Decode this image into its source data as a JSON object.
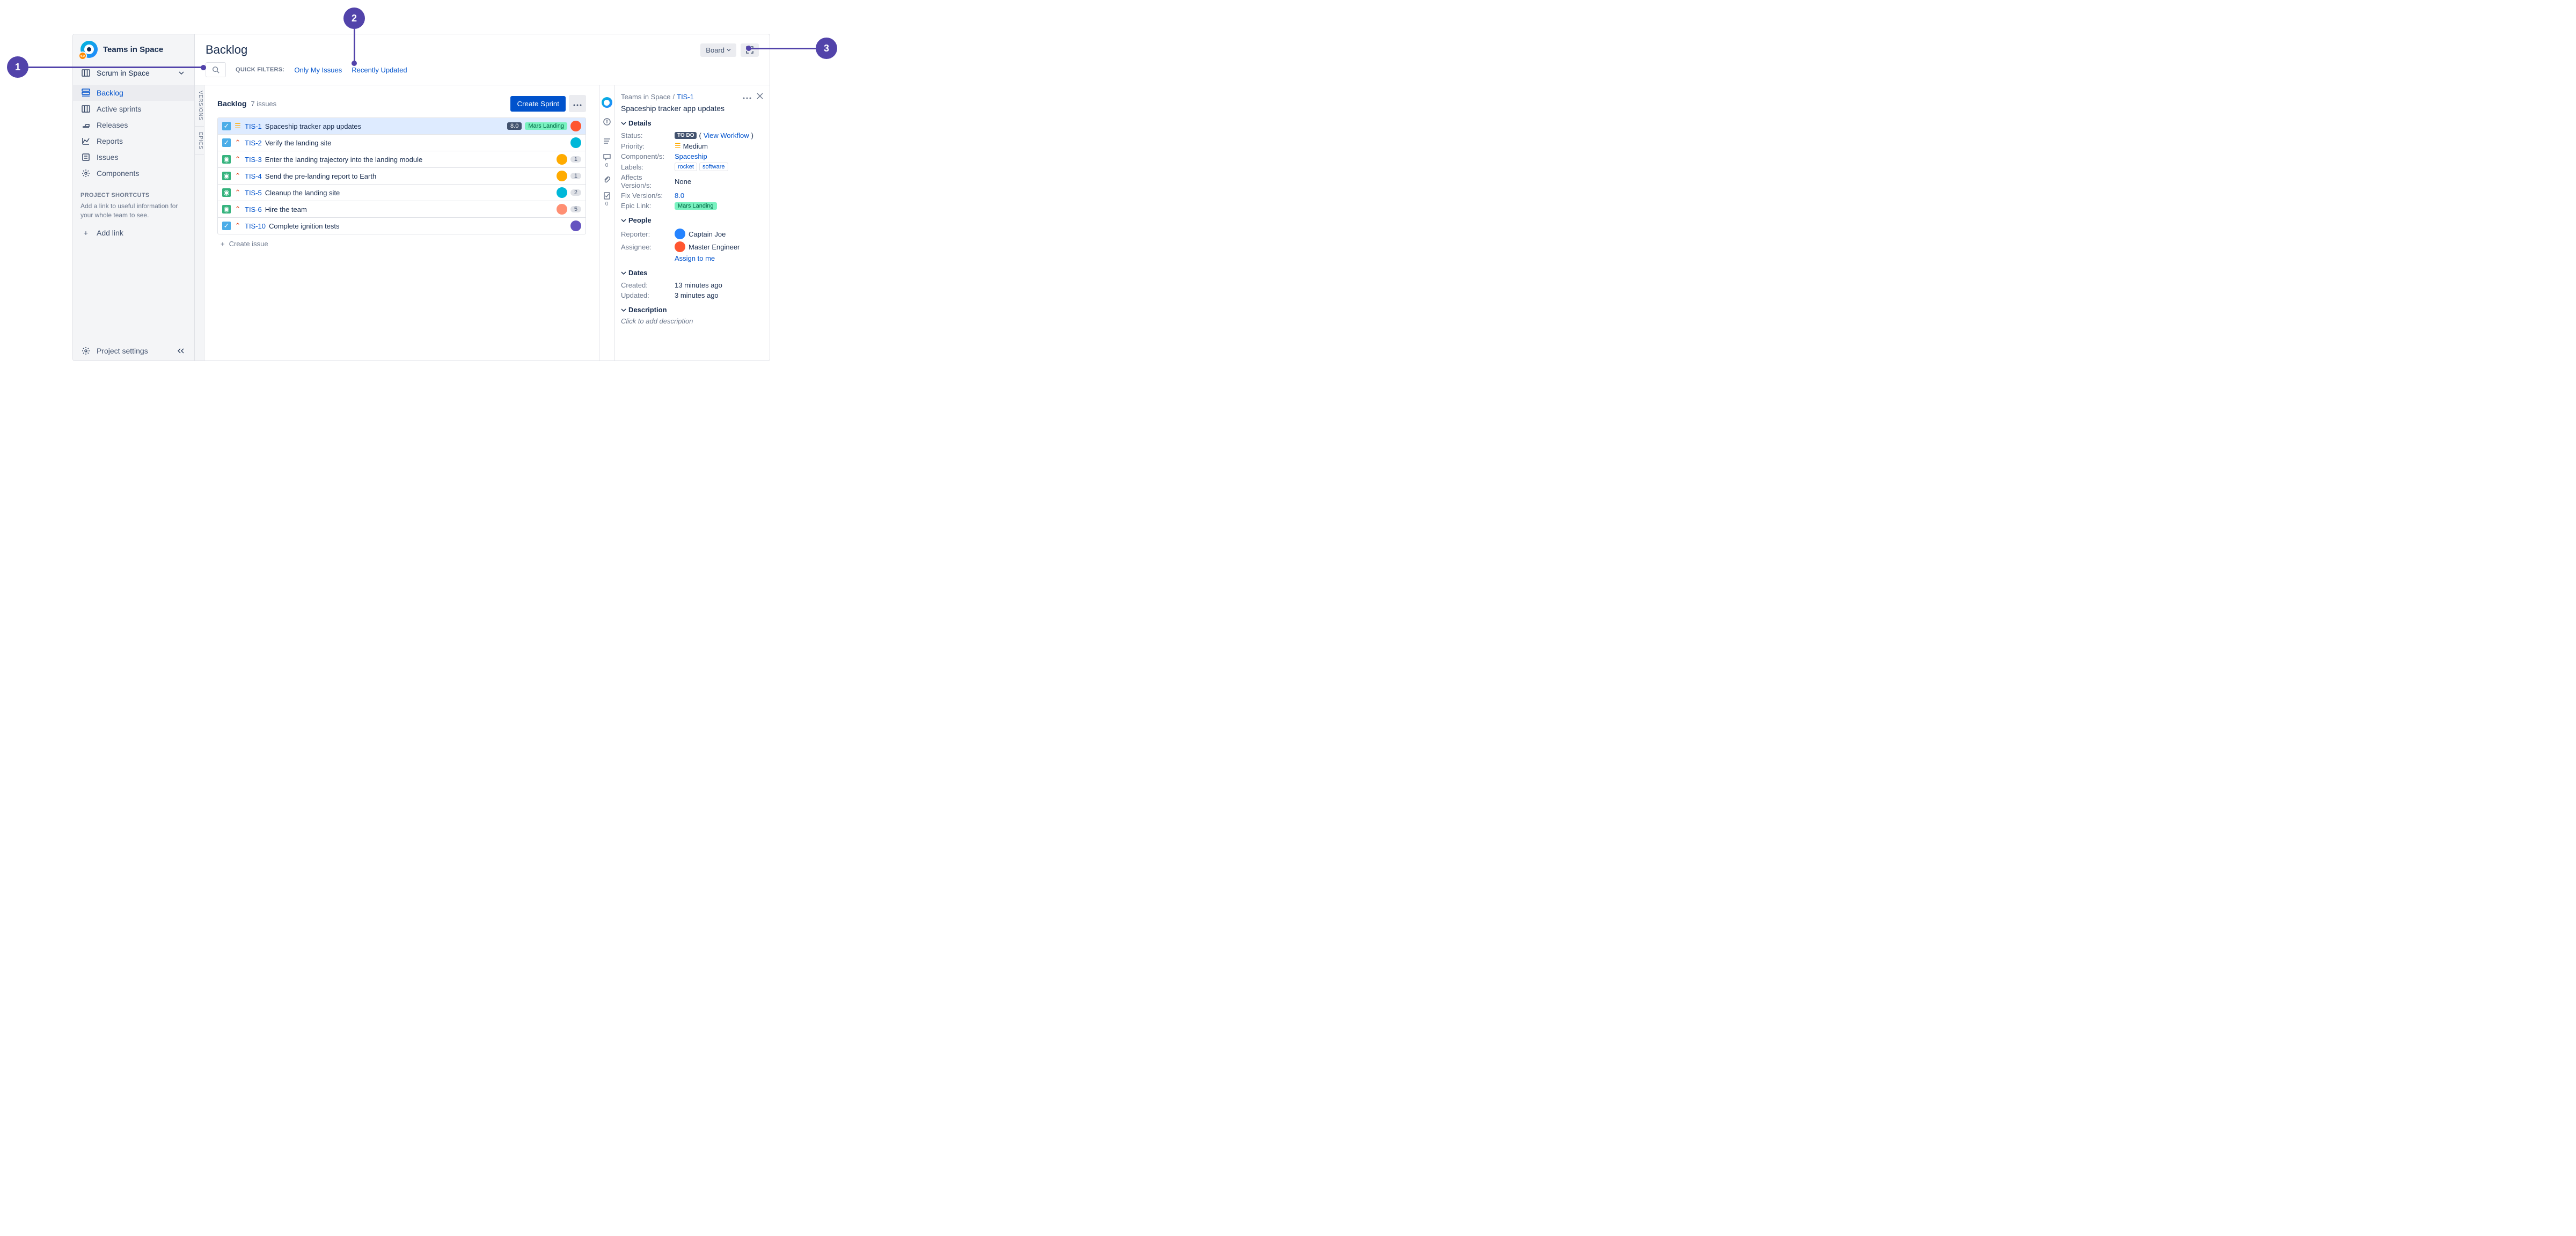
{
  "callouts": {
    "c1": "1",
    "c2": "2",
    "c3": "3"
  },
  "project": {
    "name": "Teams in Space",
    "board": "Scrum in Space"
  },
  "nav": {
    "backlog": "Backlog",
    "active_sprints": "Active sprints",
    "releases": "Releases",
    "reports": "Reports",
    "issues": "Issues",
    "components": "Components"
  },
  "shortcuts": {
    "title": "PROJECT SHORTCUTS",
    "desc": "Add a link to useful information for your whole team to see.",
    "add": "Add link"
  },
  "footer": {
    "settings": "Project settings"
  },
  "header": {
    "title": "Backlog",
    "board_btn": "Board",
    "filters_label": "QUICK FILTERS:",
    "filter_my": "Only My Issues",
    "filter_recent": "Recently Updated"
  },
  "vtabs": {
    "versions": "VERSIONS",
    "epics": "EPICS"
  },
  "backlog": {
    "title": "Backlog",
    "count": "7 issues",
    "create_sprint": "Create Sprint",
    "create_issue": "Create issue",
    "issues": [
      {
        "type": "task",
        "prio": "med",
        "key": "TIS-1",
        "summary": "Spaceship tracker app updates",
        "version": "8.0",
        "epic": "Mars Landing",
        "avatar_color": "#FF5630",
        "count": null,
        "selected": true
      },
      {
        "type": "task",
        "prio": "high",
        "key": "TIS-2",
        "summary": "Verify the landing site",
        "version": null,
        "epic": null,
        "avatar_color": "#00B8D9",
        "count": null,
        "selected": false
      },
      {
        "type": "story",
        "prio": "high",
        "key": "TIS-3",
        "summary": "Enter the landing trajectory into the landing module",
        "version": null,
        "epic": null,
        "avatar_color": "#FFAB00",
        "count": "1",
        "selected": false
      },
      {
        "type": "story",
        "prio": "high",
        "key": "TIS-4",
        "summary": "Send the pre-landing report to Earth",
        "version": null,
        "epic": null,
        "avatar_color": "#FFAB00",
        "count": "1",
        "selected": false
      },
      {
        "type": "story",
        "prio": "high",
        "key": "TIS-5",
        "summary": "Cleanup the landing site",
        "version": null,
        "epic": null,
        "avatar_color": "#00B8D9",
        "count": "2",
        "selected": false
      },
      {
        "type": "story",
        "prio": "high",
        "key": "TIS-6",
        "summary": "Hire the team",
        "version": null,
        "epic": null,
        "avatar_color": "#FF8F73",
        "count": "5",
        "selected": false
      },
      {
        "type": "task",
        "prio": "high",
        "key": "TIS-10",
        "summary": "Complete ignition tests",
        "version": null,
        "epic": null,
        "avatar_color": "#6554C0",
        "count": null,
        "selected": false
      }
    ]
  },
  "rail": {
    "comments": "0",
    "worklog": "0"
  },
  "detail": {
    "project": "Teams in Space",
    "key": "TIS-1",
    "title": "Spaceship tracker app updates",
    "sections": {
      "details": "Details",
      "people": "People",
      "dates": "Dates",
      "description": "Description"
    },
    "fields": {
      "status_label": "Status:",
      "status_val": "TO DO",
      "status_link": "View Workflow",
      "priority_label": "Priority:",
      "priority_val": "Medium",
      "components_label": "Component/s:",
      "components_val": "Spaceship",
      "labels_label": "Labels:",
      "label1": "rocket",
      "label2": "software",
      "affects_label": "Affects Version/s:",
      "affects_val": "None",
      "fix_label": "Fix Version/s:",
      "fix_val": "8.0",
      "epic_label": "Epic Link:",
      "epic_val": "Mars Landing",
      "reporter_label": "Reporter:",
      "reporter_val": "Captain Joe",
      "assignee_label": "Assignee:",
      "assignee_val": "Master Engineer",
      "assign_me": "Assign to me",
      "created_label": "Created:",
      "created_val": "13 minutes ago",
      "updated_label": "Updated:",
      "updated_val": "3 minutes ago",
      "desc_placeholder": "Click to add description"
    }
  }
}
